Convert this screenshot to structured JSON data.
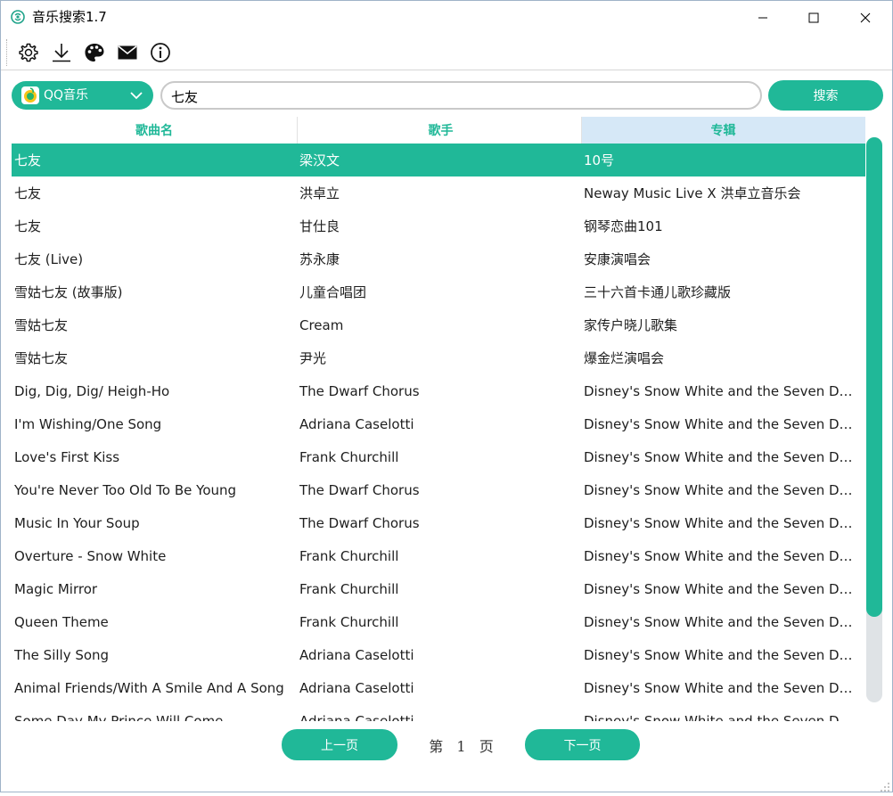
{
  "window": {
    "title": "音乐搜索1.7",
    "controls": {
      "minimize": "minimize-icon",
      "maximize": "maximize-icon",
      "close": "close-icon"
    }
  },
  "toolbar": {
    "items": [
      {
        "name": "settings",
        "icon": "gear-icon"
      },
      {
        "name": "download",
        "icon": "download-icon"
      },
      {
        "name": "theme",
        "icon": "palette-icon"
      },
      {
        "name": "mail",
        "icon": "mail-icon"
      },
      {
        "name": "about",
        "icon": "info-icon"
      }
    ]
  },
  "search": {
    "source": "QQ音乐",
    "query": "七友",
    "button_label": "搜索"
  },
  "table": {
    "columns": [
      "歌曲名",
      "歌手",
      "专辑"
    ],
    "sorted_column": 2,
    "selected_row": 0,
    "rows": [
      [
        "七友",
        "梁汉文",
        "10号"
      ],
      [
        "七友",
        "洪卓立",
        "Neway Music Live X 洪卓立音乐会"
      ],
      [
        "七友",
        "甘仕良",
        "钢琴恋曲101"
      ],
      [
        "七友 (Live)",
        "苏永康",
        "安康演唱会"
      ],
      [
        "雪姑七友 (故事版)",
        "儿童合唱团",
        "三十六首卡通儿歌珍藏版"
      ],
      [
        "雪姑七友",
        "Cream",
        "家传户晓儿歌集"
      ],
      [
        "雪姑七友",
        "尹光",
        "爆金烂演唱会"
      ],
      [
        "Dig, Dig, Dig/ Heigh-Ho",
        "The Dwarf Chorus",
        "Disney's Snow White and the Seven Dwar..."
      ],
      [
        "I'm Wishing/One Song",
        "Adriana Caselotti",
        "Disney's Snow White and the Seven Dwar..."
      ],
      [
        "Love's First Kiss",
        "Frank Churchill",
        "Disney's Snow White and the Seven Dwar..."
      ],
      [
        "You're Never Too Old To Be Young",
        "The Dwarf Chorus",
        "Disney's Snow White and the Seven Dwar..."
      ],
      [
        "Music In Your Soup",
        "The Dwarf Chorus",
        "Disney's Snow White and the Seven Dwar..."
      ],
      [
        "Overture - Snow White",
        "Frank Churchill",
        "Disney's Snow White and the Seven Dwar..."
      ],
      [
        "Magic Mirror",
        "Frank Churchill",
        "Disney's Snow White and the Seven Dwar..."
      ],
      [
        "Queen Theme",
        "Frank Churchill",
        "Disney's Snow White and the Seven Dwar..."
      ],
      [
        "The Silly Song",
        "Adriana Caselotti",
        "Disney's Snow White and the Seven Dwar..."
      ],
      [
        "Animal Friends/With A Smile And A Song",
        "Adriana Caselotti",
        "Disney's Snow White and the Seven Dwar..."
      ],
      [
        "Some Day My Prince Will Come",
        "Adriana Caselotti",
        "Disney's Snow White and the Seven Dwar..."
      ]
    ]
  },
  "pagination": {
    "prev_label": "上一页",
    "next_label": "下一页",
    "page_prefix": "第",
    "page_number": "1",
    "page_suffix": "页"
  },
  "colors": {
    "accent": "#20b898",
    "header_active_bg": "#d6e8f7",
    "scroll_track": "#dfe3e6"
  }
}
